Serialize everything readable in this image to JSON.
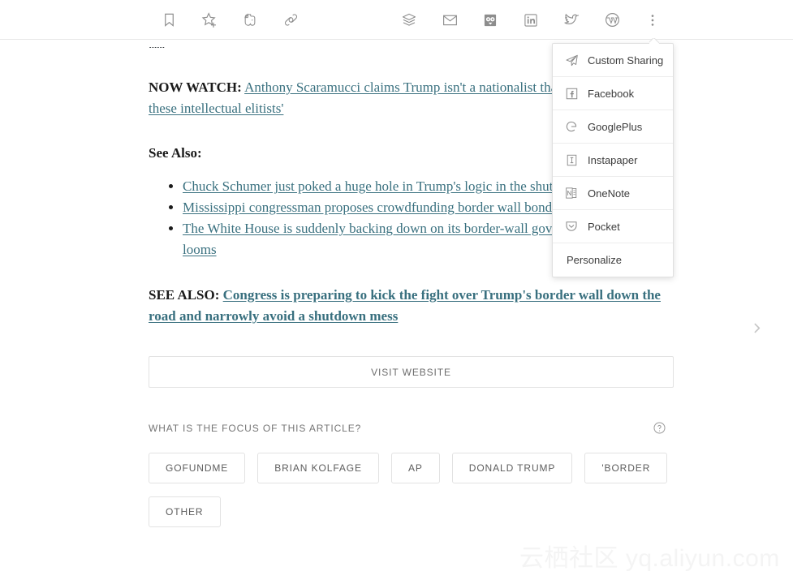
{
  "toolbar": {
    "left_actions": [
      {
        "name": "bookmark-icon",
        "label": "Bookmark"
      },
      {
        "name": "favorite-star-icon",
        "label": "Add to favorites"
      },
      {
        "name": "evernote-icon",
        "label": "Evernote"
      },
      {
        "name": "copy-link-icon",
        "label": "Copy link"
      }
    ],
    "right_actions": [
      {
        "name": "buffer-icon",
        "label": "Buffer"
      },
      {
        "name": "email-icon",
        "label": "Email"
      },
      {
        "name": "hootsuite-icon",
        "label": "Hootsuite"
      },
      {
        "name": "linkedin-icon",
        "label": "LinkedIn"
      },
      {
        "name": "twitter-icon",
        "label": "Twitter"
      },
      {
        "name": "wordpress-icon",
        "label": "WordPress"
      },
      {
        "name": "more-options-icon",
        "label": "More options"
      }
    ]
  },
  "share_menu": {
    "items": [
      {
        "icon": "paper-plane-icon",
        "label": "Custom Sharing"
      },
      {
        "icon": "facebook-icon",
        "label": "Facebook"
      },
      {
        "icon": "googleplus-icon",
        "label": "GooglePlus"
      },
      {
        "icon": "instapaper-icon",
        "label": "Instapaper"
      },
      {
        "icon": "onenote-icon",
        "label": "OneNote"
      },
      {
        "icon": "pocket-icon",
        "label": "Pocket"
      }
    ],
    "personalize_label": "Personalize"
  },
  "article": {
    "clipped_top_text": "......",
    "now_watch_label": "NOW WATCH:",
    "now_watch_link": "Anthony Scaramucci claims Trump isn't a nationalist that because it irks these intellectual elitists'",
    "see_also_heading": "See Also:",
    "related_links": [
      "Chuck Schumer just poked a huge hole in Trump's logic in the shutdown fight",
      "Mississippi congressman proposes crowdfunding border wall bonds'",
      "The White House is suddenly backing down on its border-wall government shutdown looms"
    ],
    "see_also_label": "SEE ALSO:",
    "see_also_link": "Congress is preparing to kick the fight over Trump's border wall down the road and narrowly avoid a shutdown mess",
    "visit_website_label": "VISIT WEBSITE"
  },
  "focus_section": {
    "title": "WHAT IS THE FOCUS OF THIS ARTICLE?",
    "help_icon": "help-circle-icon",
    "tags": [
      "GOFUNDME",
      "BRIAN KOLFAGE",
      "AP",
      "DONALD TRUMP",
      "'BORDER",
      "OTHER"
    ]
  },
  "navigation": {
    "next_label": "Next article"
  },
  "watermark": {
    "text": "云栖社区 yq.aliyun.com"
  },
  "colors": {
    "link": "#39707f",
    "text": "#1a1a1a",
    "muted": "#757575",
    "border": "#e2e2e2"
  }
}
